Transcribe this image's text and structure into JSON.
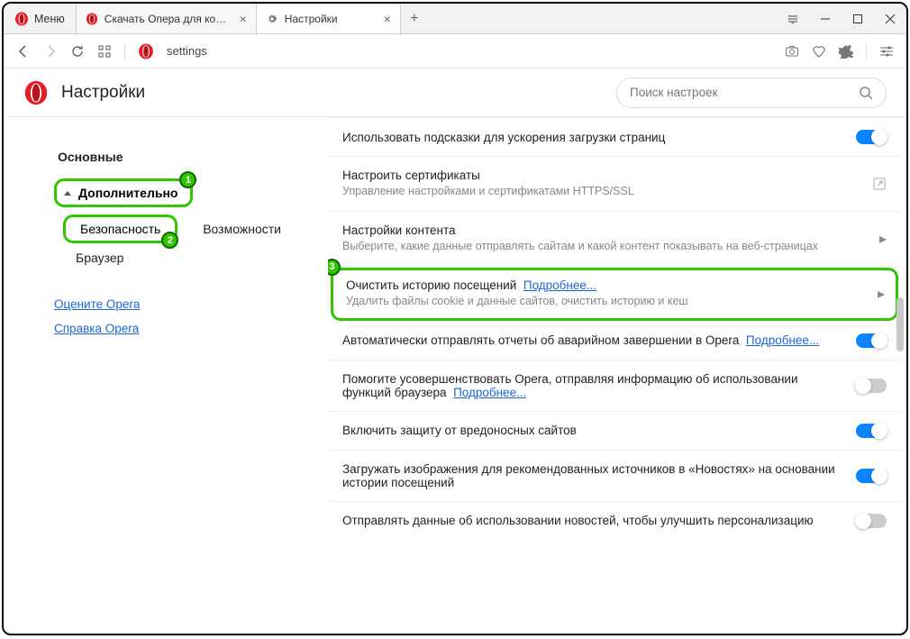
{
  "titlebar": {
    "menu_label": "Меню",
    "tabs": [
      {
        "title": "Скачать Опера для компь",
        "icon": "opera"
      },
      {
        "title": "Настройки",
        "icon": "gear"
      }
    ]
  },
  "addressbar": {
    "url_text": "settings"
  },
  "header": {
    "title": "Настройки",
    "search_placeholder": "Поиск настроек"
  },
  "sidebar": {
    "basic": "Основные",
    "advanced": "Дополнительно",
    "security": "Безопасность",
    "features": "Возможности",
    "browser": "Браузер",
    "rate": "Оцените Opera",
    "help": "Справка Opera"
  },
  "rows": {
    "r0": {
      "title": "Использовать подсказки для ускорения загрузки страниц",
      "toggle": true
    },
    "r1": {
      "title": "Настроить сертификаты",
      "sub": "Управление настройками и сертификатами HTTPS/SSL"
    },
    "r2": {
      "title": "Настройки контента",
      "sub": "Выберите, какие данные отправлять сайтам и какой контент показывать на веб-страницах"
    },
    "r3": {
      "title": "Очистить историю посещений",
      "link": "Подробнее...",
      "sub": "Удалить файлы cookie и данные сайтов, очистить историю и кеш"
    },
    "r4": {
      "title_a": "Автоматически отправлять отчеты об аварийном завершении в Opera",
      "link": "Подробнее...",
      "toggle": true
    },
    "r5": {
      "title_a": "Помогите усовершенствовать Opera, отправляя информацию об использовании функций браузера",
      "link": "Подробнее...",
      "toggle": false
    },
    "r6": {
      "title": "Включить защиту от вредоносных сайтов",
      "toggle": true
    },
    "r7": {
      "title": "Загружать изображения для рекомендованных источников в «Новостях» на основании истории посещений",
      "toggle": true
    },
    "r8": {
      "title": "Отправлять данные об использовании новостей, чтобы улучшить персонализацию",
      "toggle": false
    }
  },
  "badges": {
    "b1": "1",
    "b2": "2",
    "b3": "3"
  }
}
